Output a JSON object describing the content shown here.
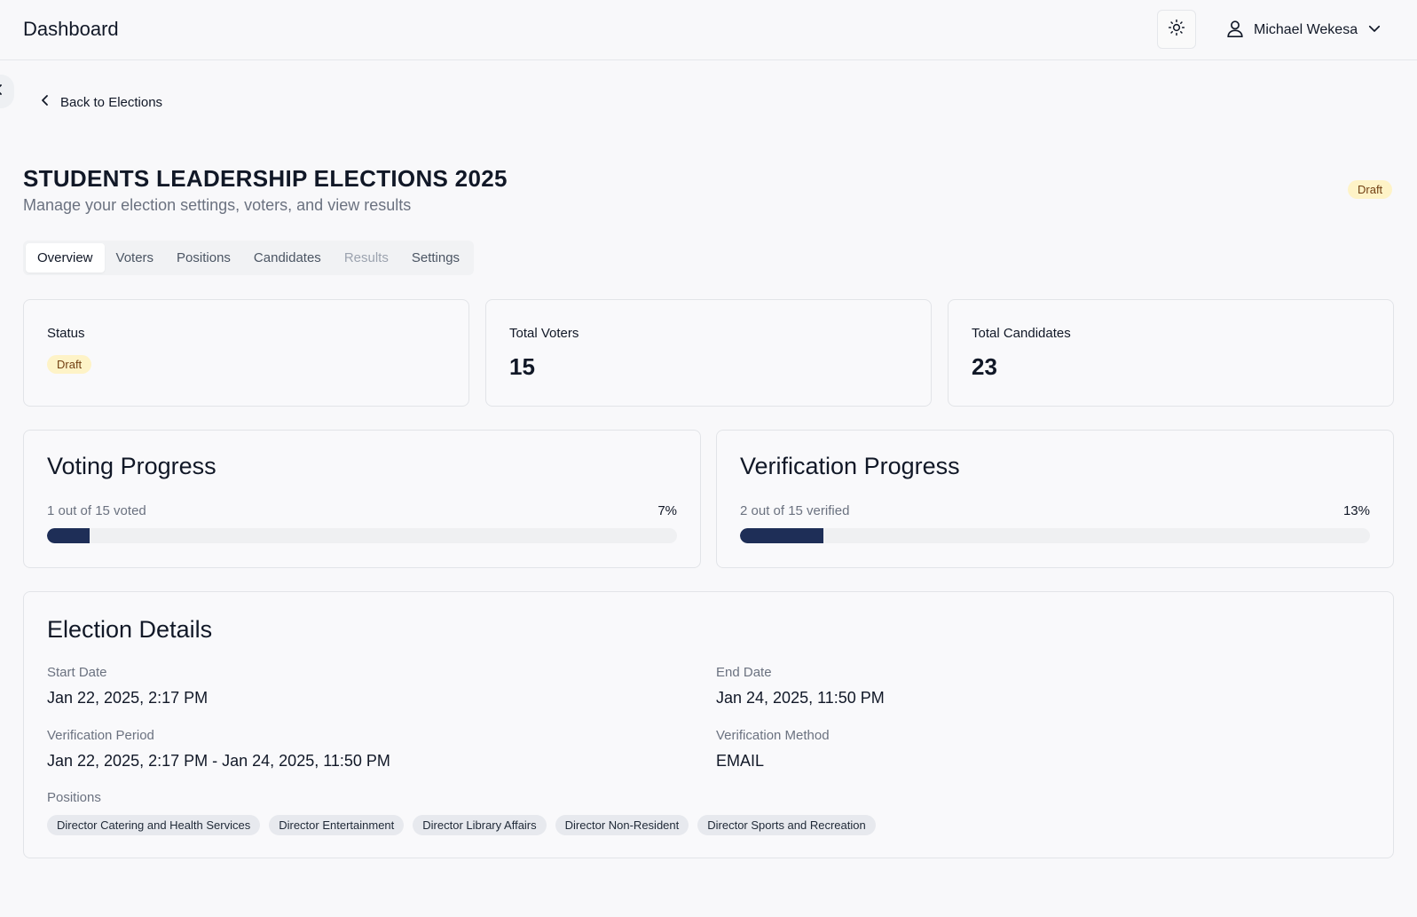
{
  "header": {
    "title": "Dashboard",
    "theme_icon": "sun-icon",
    "user_name": "Michael Wekesa"
  },
  "nav": {
    "back_label": "Back to Elections"
  },
  "election": {
    "title": "STUDENTS LEADERSHIP ELECTIONS 2025",
    "subtitle": "Manage your election settings, voters, and view results",
    "status_badge": "Draft"
  },
  "tabs": [
    {
      "label": "Overview",
      "state": "active"
    },
    {
      "label": "Voters",
      "state": "normal"
    },
    {
      "label": "Positions",
      "state": "normal"
    },
    {
      "label": "Candidates",
      "state": "normal"
    },
    {
      "label": "Results",
      "state": "disabled"
    },
    {
      "label": "Settings",
      "state": "normal"
    }
  ],
  "stats": {
    "status": {
      "label": "Status",
      "badge": "Draft"
    },
    "voters": {
      "label": "Total Voters",
      "value": "15"
    },
    "candidates": {
      "label": "Total Candidates",
      "value": "23"
    }
  },
  "voting_progress": {
    "title": "Voting Progress",
    "text": "1 out of 15 voted",
    "percent_label": "7%",
    "fraction": 0.067
  },
  "verification_progress": {
    "title": "Verification Progress",
    "text": "2 out of 15 verified",
    "percent_label": "13%",
    "fraction": 0.133
  },
  "details": {
    "title": "Election Details",
    "start_label": "Start Date",
    "start_value": "Jan 22, 2025, 2:17 PM",
    "end_label": "End Date",
    "end_value": "Jan 24, 2025, 11:50 PM",
    "verification_period_label": "Verification Period",
    "verification_period_value": "Jan 22, 2025, 2:17 PM - Jan 24, 2025, 11:50 PM",
    "verification_method_label": "Verification Method",
    "verification_method_value": "EMAIL",
    "positions_label": "Positions",
    "positions": [
      "Director Catering and Health Services",
      "Director Entertainment",
      "Director Library Affairs",
      "Director Non-Resident",
      "Director Sports and Recreation"
    ]
  },
  "colors": {
    "accent": "#1e2e57",
    "badge_bg": "#fef3c7",
    "badge_text": "#713f12"
  }
}
